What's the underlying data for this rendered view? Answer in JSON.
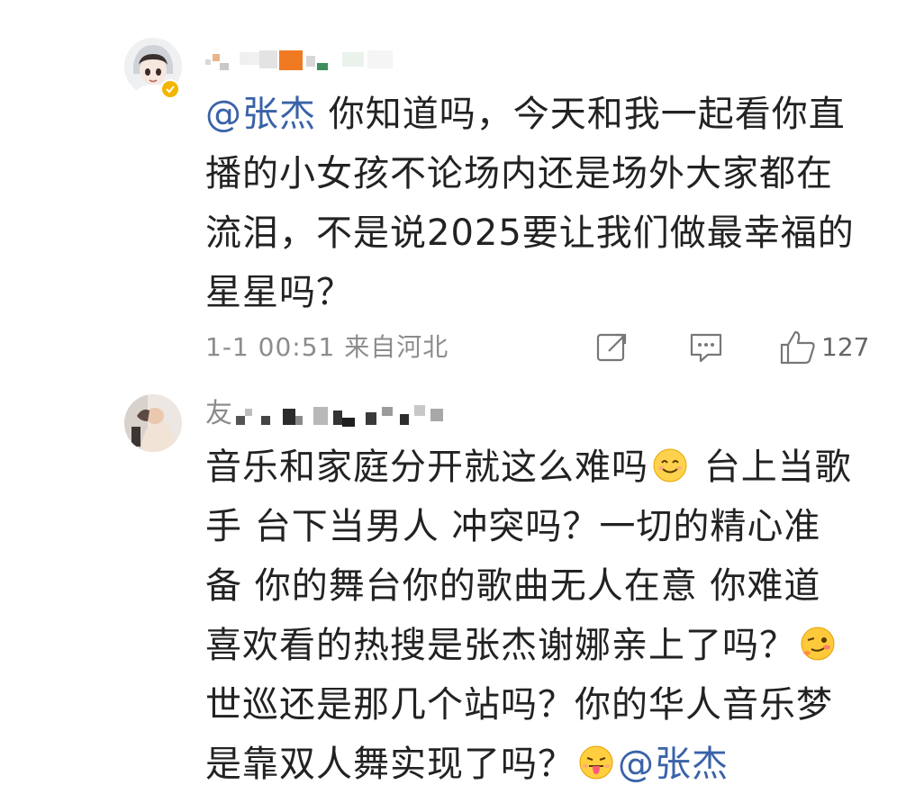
{
  "comments": [
    {
      "avatar_icon": "anime-avatar-icon",
      "verified_badge_icon": "verified-badge-icon",
      "username_visible": "",
      "mention": "@张杰",
      "text_after_mention": " 你知道吗，今天和我一起看你直\n播的小女孩不论场内还是场外大家都在\n流泪，不是说2025要让我们做最幸福的\n星星吗？",
      "time_location": "1-1 00:51  来自河北",
      "actions": {
        "share_icon": "share-icon",
        "comment_icon": "comment-icon",
        "like_icon": "thumbs-up-icon",
        "like_count": "127"
      }
    },
    {
      "avatar_icon": "user-avatar-icon",
      "username_visible": "友",
      "text_part_1": "音乐和家庭分开就这么难吗",
      "emoji_1": "smile-emoji-icon",
      "text_part_2": " 台上当歌\n手  台下当男人  冲突吗？一切的精心准\n备  你的舞台你的歌曲无人在意  你难道\n喜欢看的热搜是张杰谢娜亲上了吗？",
      "emoji_2": "wink-emoji-icon",
      "text_part_3": "\n世巡还是那几个站吗？你的华人音乐梦\n是靠双人舞实现了吗？",
      "emoji_3": "tongue-emoji-icon",
      "mention": "@张杰"
    }
  ],
  "colors": {
    "mention": "#3a62a8",
    "text": "#222222",
    "meta": "#8c8c8c",
    "badge": "#f2b600"
  }
}
